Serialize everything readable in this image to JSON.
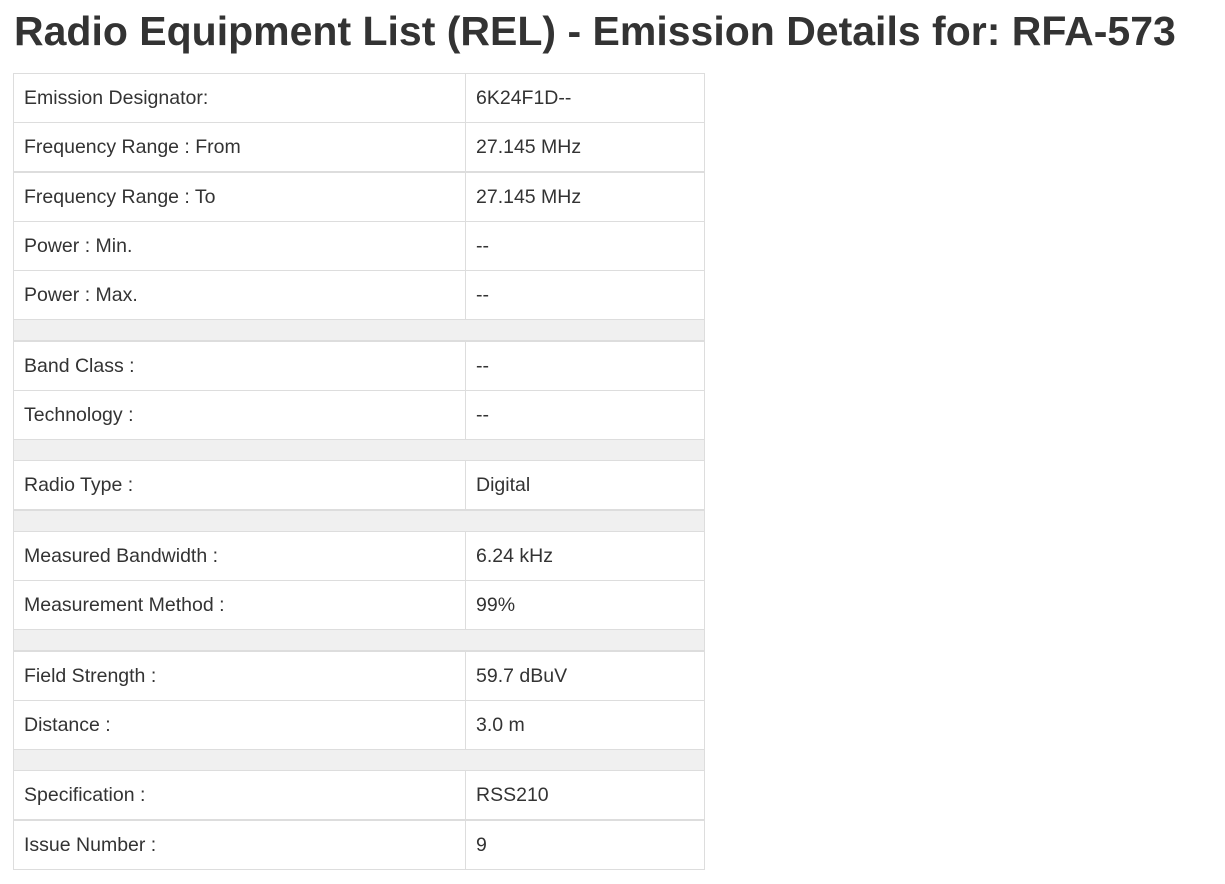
{
  "page": {
    "title": "Radio Equipment List (REL) - Emission Details for: RFA-573"
  },
  "groups": [
    {
      "rows": [
        {
          "label": "Emission Designator:",
          "value": "6K24F1D--"
        },
        {
          "label": "Frequency Range : From",
          "value": "27.145 MHz"
        },
        {
          "label": "Frequency Range : To",
          "value": "27.145 MHz"
        },
        {
          "label": "Power : Min.",
          "value": "--"
        },
        {
          "label": "Power : Max.",
          "value": "--"
        }
      ]
    },
    {
      "rows": [
        {
          "label": "Band Class :",
          "value": "--"
        },
        {
          "label": "Technology :",
          "value": "--"
        }
      ]
    },
    {
      "rows": [
        {
          "label": "Radio Type :",
          "value": "Digital"
        }
      ]
    },
    {
      "rows": [
        {
          "label": "Measured Bandwidth :",
          "value": "6.24 kHz"
        },
        {
          "label": "Measurement Method :",
          "value": "99%"
        }
      ]
    },
    {
      "rows": [
        {
          "label": "Field Strength :",
          "value": "59.7 dBuV"
        },
        {
          "label": "Distance :",
          "value": "3.0 m"
        }
      ]
    },
    {
      "rows": [
        {
          "label": "Specification :",
          "value": "RSS210"
        },
        {
          "label": "Issue Number :",
          "value": "9"
        }
      ]
    }
  ]
}
